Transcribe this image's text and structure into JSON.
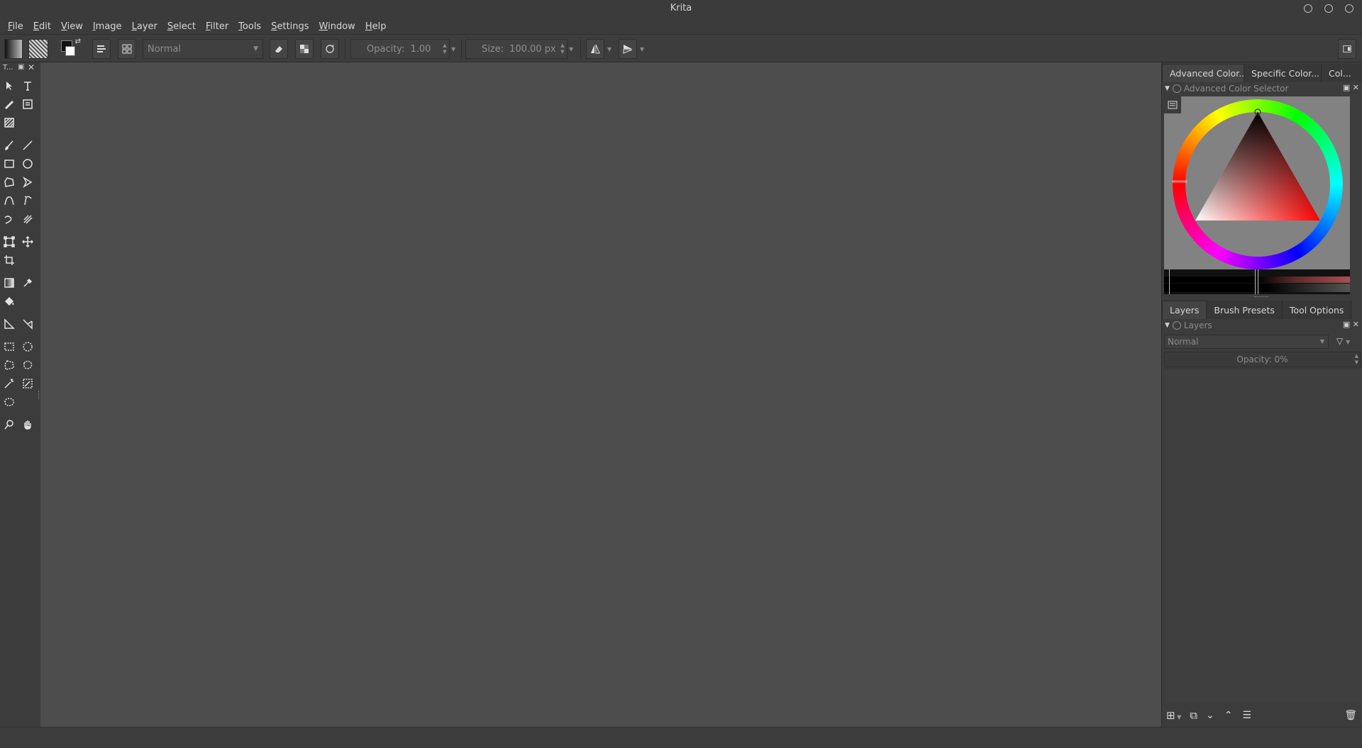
{
  "window": {
    "title": "Krita"
  },
  "menu": [
    "File",
    "Edit",
    "View",
    "Image",
    "Layer",
    "Select",
    "Filter",
    "Tools",
    "Settings",
    "Window",
    "Help"
  ],
  "tool_options": {
    "blend_mode": "Normal",
    "opacity_label": "Opacity:",
    "opacity_value": "1.00",
    "size_label": "Size:",
    "size_value": "100.00 px"
  },
  "toolbox": {
    "header": "T..."
  },
  "docker_top": {
    "tabs": [
      "Advanced Color...",
      "Specific Color...",
      "Col..."
    ],
    "title": "Advanced Color Selector"
  },
  "docker_bottom": {
    "tabs": [
      "Layers",
      "Brush Presets",
      "Tool Options"
    ],
    "title": "Layers",
    "blend_mode": "Normal",
    "opacity_label": "Opacity:",
    "opacity_value": "0%"
  },
  "icons": {
    "toolbox": [
      "pointer-icon",
      "text-icon",
      "freehand-path-icon",
      "calligraphy-icon",
      "pattern-edit-icon",
      "brush-icon",
      "line-icon",
      "rectangle-icon",
      "ellipse-icon",
      "polygon-icon",
      "polyline-icon",
      "bezier-icon",
      "freehand-path-icon",
      "dynamic-brush-icon",
      "multibrush-icon",
      "transform-icon",
      "move-icon",
      "crop-icon",
      "gradient-icon",
      "color-picker-icon",
      "fill-icon",
      "measure-icon",
      "assistant-icon",
      "rect-select-icon",
      "ellipse-select-icon",
      "polygon-select-icon",
      "freehand-select-icon",
      "magic-wand-icon",
      "similar-select-icon",
      "bezier-select-icon",
      "zoom-icon",
      "pan-icon"
    ]
  },
  "colors": {
    "background": "#4d4d4d",
    "panel": "#3c3c3c",
    "accent_hue_marker": "#ff0000"
  }
}
